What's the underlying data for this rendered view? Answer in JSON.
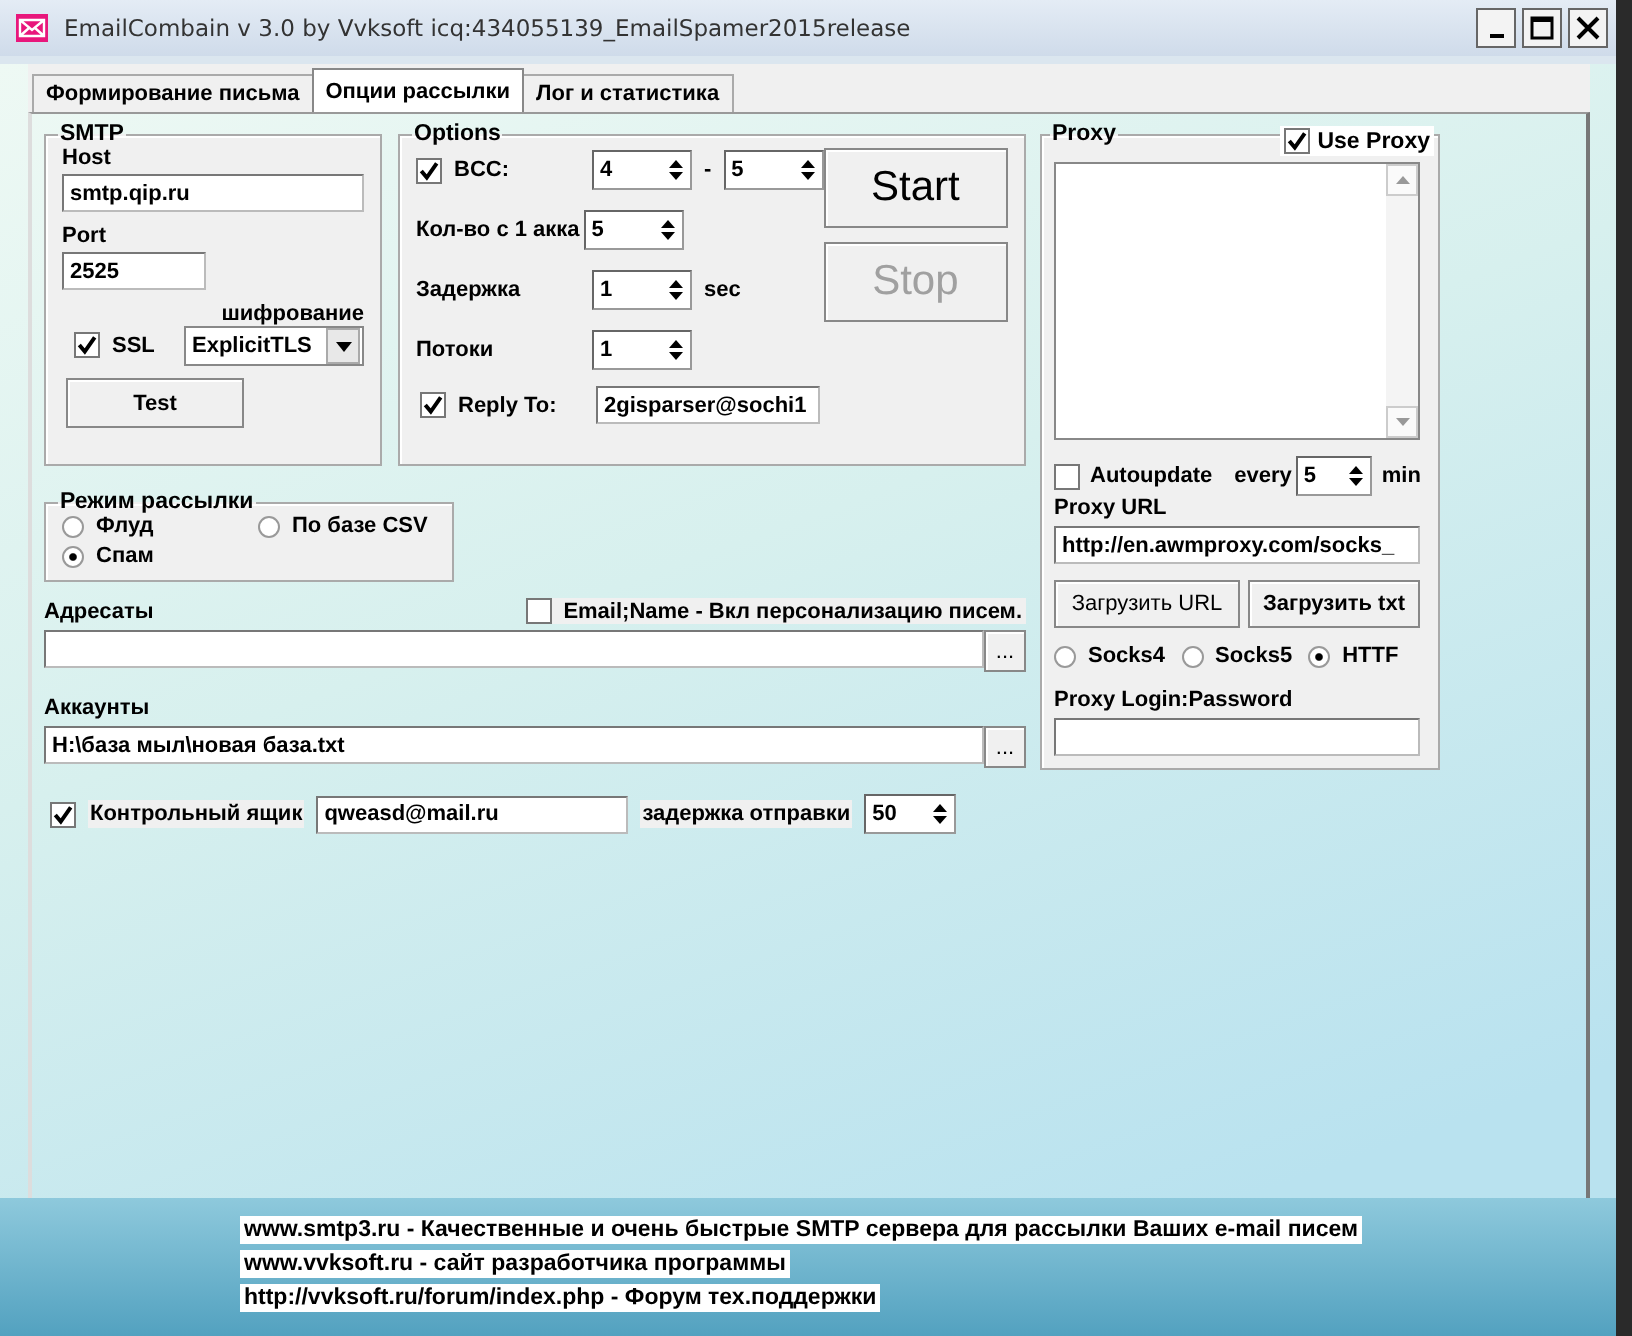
{
  "window": {
    "title": "EmailCombain v 3.0 by Vvksoft  icq:434055139_EmailSpamer2015release"
  },
  "tabs": [
    {
      "label": "Формирование письма",
      "selected": false
    },
    {
      "label": "Опции рассылки",
      "selected": true
    },
    {
      "label": "Лог и статистика",
      "selected": false
    }
  ],
  "smtp": {
    "title": "SMTP",
    "host_label": "Host",
    "host": "smtp.qip.ru",
    "port_label": "Port",
    "port": "2525",
    "ssl": {
      "label": "SSL",
      "checked": true
    },
    "encryption_label": "шифрование",
    "encryption": "ExplicitTLS",
    "test_button": "Test"
  },
  "options": {
    "title": "Options",
    "bcc": {
      "label": "BCC:",
      "checked": true,
      "from": "4",
      "dash": "-",
      "to": "5"
    },
    "per_account": {
      "label": "Кол-во с 1 акка",
      "value": "5"
    },
    "delay": {
      "label": "Задержка",
      "value": "1",
      "unit": "sec"
    },
    "threads": {
      "label": "Потоки",
      "value": "1"
    },
    "reply_to": {
      "label": "Reply To:",
      "checked": true,
      "value": "2gisparser@sochi1"
    },
    "start_button": {
      "label": "Start",
      "disabled": false
    },
    "stop_button": {
      "label": "Stop",
      "disabled": true
    }
  },
  "mode": {
    "title": "Режим рассылки",
    "options": [
      {
        "label": "Флуд",
        "selected": false
      },
      {
        "label": "По базе CSV",
        "selected": false
      },
      {
        "label": "Спам",
        "selected": true
      }
    ]
  },
  "recipients": {
    "label": "Адресаты",
    "personalize": {
      "label": "Email;Name - Вкл персонализацию писем.",
      "checked": false
    },
    "browse": "..."
  },
  "accounts": {
    "label": "Аккаунты",
    "value": "H:\\база мыл\\новая база.txt",
    "browse": "..."
  },
  "control_box": {
    "label": "Контрольный ящик",
    "checked": true,
    "value": "qweasd@mail.ru",
    "send_delay_label": "задержка отправки",
    "send_delay": "50"
  },
  "proxy": {
    "title": "Proxy",
    "use_proxy": {
      "label": "Use Proxy",
      "checked": true
    },
    "autoupdate": {
      "label": "Autoupdate",
      "checked": false
    },
    "every_label": "every",
    "every": "5",
    "unit": "min",
    "url_label": "Proxy URL",
    "url": "http://en.awmproxy.com/socks_",
    "load_url_button": "Загрузить URL",
    "load_txt_button": "Загрузить txt",
    "types": [
      {
        "label": "Socks4",
        "selected": false
      },
      {
        "label": "Socks5",
        "selected": false
      },
      {
        "label": "HTTF",
        "selected": true
      }
    ],
    "login_label": "Proxy Login:Password"
  },
  "footer_links": [
    "www.smtp3.ru - Качественные и очень быстрые SMTP сервера для рассылки Ваших e-mail писем",
    "www.vvksoft.ru - сайт разработчика программы",
    "http://vvksoft.ru/forum/index.php - Форум тех.поддержки"
  ]
}
